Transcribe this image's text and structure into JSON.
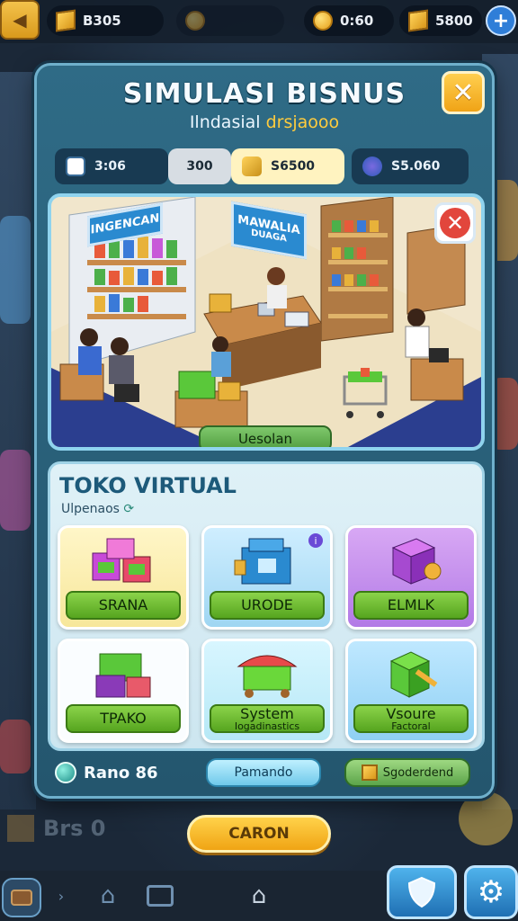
{
  "topbar": {
    "left_value": "B305",
    "right_coins": "0:60",
    "right_cubes": "5800"
  },
  "panel": {
    "title": "SIMULASI BISNUS",
    "subtitle_a": "Ilndasial",
    "subtitle_b": "drsjaooo",
    "stats": [
      "3:06",
      "300",
      "S6500",
      "S5.060"
    ]
  },
  "scene": {
    "sign_left": "INGENCAN",
    "sign_center_1": "MAWALIA",
    "sign_center_2": "DUAGA",
    "button": "Uesolan"
  },
  "store": {
    "title": "TOKO VIRTUAL",
    "subtitle": "Ulpenaos",
    "cards": [
      {
        "label": "SRANA",
        "sub": ""
      },
      {
        "label": "URODE",
        "sub": ""
      },
      {
        "label": "ELMLK",
        "sub": ""
      },
      {
        "label": "TPAKO",
        "sub": ""
      },
      {
        "label": "System",
        "sub": "Iogadinastics"
      },
      {
        "label": "Vsoure",
        "sub": "Factoral"
      }
    ],
    "footer": {
      "rank": "Rano 86",
      "button1": "Pamando",
      "button2": "Sgoderdend"
    }
  },
  "bottom": {
    "blurred_label": "Brs 0",
    "main_button": "CARON"
  },
  "colors": {
    "panel": "#2a6a84",
    "accent_orange": "#f0a316",
    "button_green": "#56a51f"
  }
}
